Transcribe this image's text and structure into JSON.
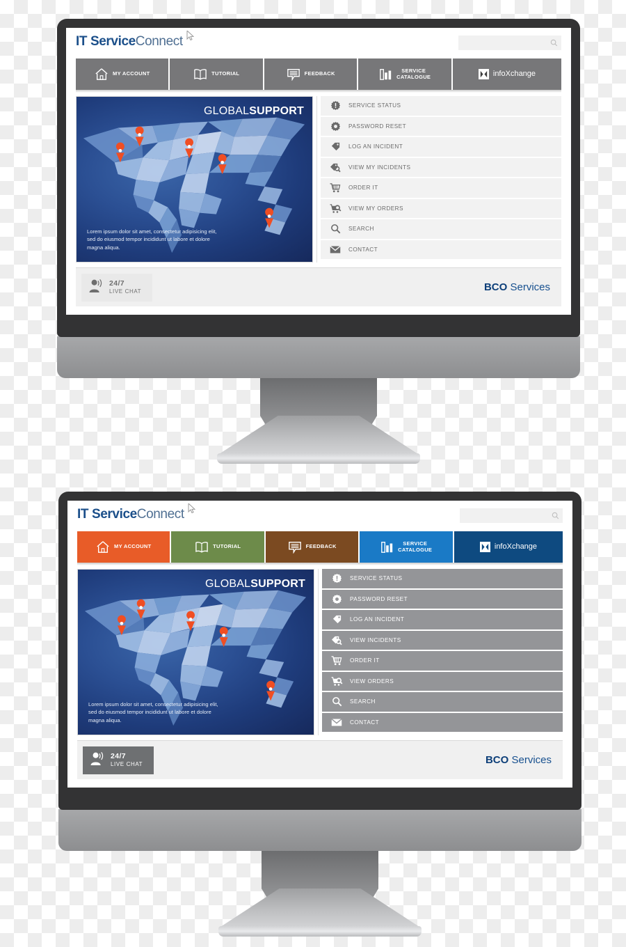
{
  "site": {
    "logo_bold": "IT Service",
    "logo_normal": "Connect",
    "cursor_icon": "mouse-pointer-icon"
  },
  "search": {
    "value": "",
    "placeholder": "",
    "icon": "search-icon"
  },
  "nav": {
    "items": [
      {
        "label": "MY ACCOUNT",
        "icon": "home-icon",
        "color_a": "#777779",
        "color_b": "#e85c28"
      },
      {
        "label": "TUTORIAL",
        "icon": "book-icon",
        "color_a": "#777779",
        "color_b": "#6d8b4a"
      },
      {
        "label": "FEEDBACK",
        "icon": "chat-bubble-icon",
        "color_a": "#777779",
        "color_b": "#7b4a21"
      },
      {
        "label": "SERVICE\nCATALOGUE",
        "icon": "bar-chart-icon",
        "color_a": "#777779",
        "color_b": "#1a7ac6"
      },
      {
        "label": "infoXchange",
        "icon": "infoxchange-logo-icon",
        "color_a": "#777779",
        "color_b": "#0e4a80"
      }
    ]
  },
  "hero": {
    "title_light": "GLOBAL",
    "title_bold": "SUPPORT",
    "body": "Lorem ipsum dolor sit amet, consectetur adipisicing elit, sed do eiusmod tempor incididunt ut labore et dolore magna aliqua.",
    "map_icon": "world-map-lowpoly",
    "pin_icon": "map-pin-icon",
    "pin_count": 5
  },
  "sidebar_top": {
    "items": [
      {
        "label": "SERVICE STATUS",
        "icon": "gear-alert-icon"
      },
      {
        "label": "PASSWORD RESET",
        "icon": "gear-icon"
      },
      {
        "label": "LOG AN INCIDENT",
        "icon": "tag-icon"
      },
      {
        "label": "VIEW MY INCIDENTS",
        "icon": "tag-search-icon"
      },
      {
        "label": "ORDER IT",
        "icon": "shopping-cart-icon"
      },
      {
        "label": "VIEW MY ORDERS",
        "icon": "cart-search-icon"
      },
      {
        "label": "SEARCH",
        "icon": "search-icon"
      },
      {
        "label": "CONTACT",
        "icon": "envelope-icon"
      }
    ]
  },
  "sidebar_bottom": {
    "items": [
      {
        "label": "SERVICE STATUS",
        "icon": "gear-alert-icon"
      },
      {
        "label": "PASSWORD RESET",
        "icon": "gear-icon"
      },
      {
        "label": "LOG AN INCIDENT",
        "icon": "tag-icon"
      },
      {
        "label": "VIEW INCIDENTS",
        "icon": "tag-search-icon"
      },
      {
        "label": "ORDER IT",
        "icon": "shopping-cart-icon"
      },
      {
        "label": "VIEW ORDERS",
        "icon": "cart-search-icon"
      },
      {
        "label": "SEARCH",
        "icon": "search-icon"
      },
      {
        "label": "CONTACT",
        "icon": "envelope-icon"
      }
    ]
  },
  "footer": {
    "chat_primary": "24/7",
    "chat_secondary": "LIVE CHAT",
    "chat_icon": "headset-user-icon",
    "brand_bold": "BCO",
    "brand_normal": " Services"
  },
  "colors": {
    "bezel": "#333334",
    "chin": "#9b9c9e",
    "nav_gray": "#777779",
    "sidebar_gray_light": "#f2f2f2",
    "sidebar_gray_dark": "#949598",
    "brand_blue": "#0d3f79",
    "pin_orange": "#f04e23"
  }
}
